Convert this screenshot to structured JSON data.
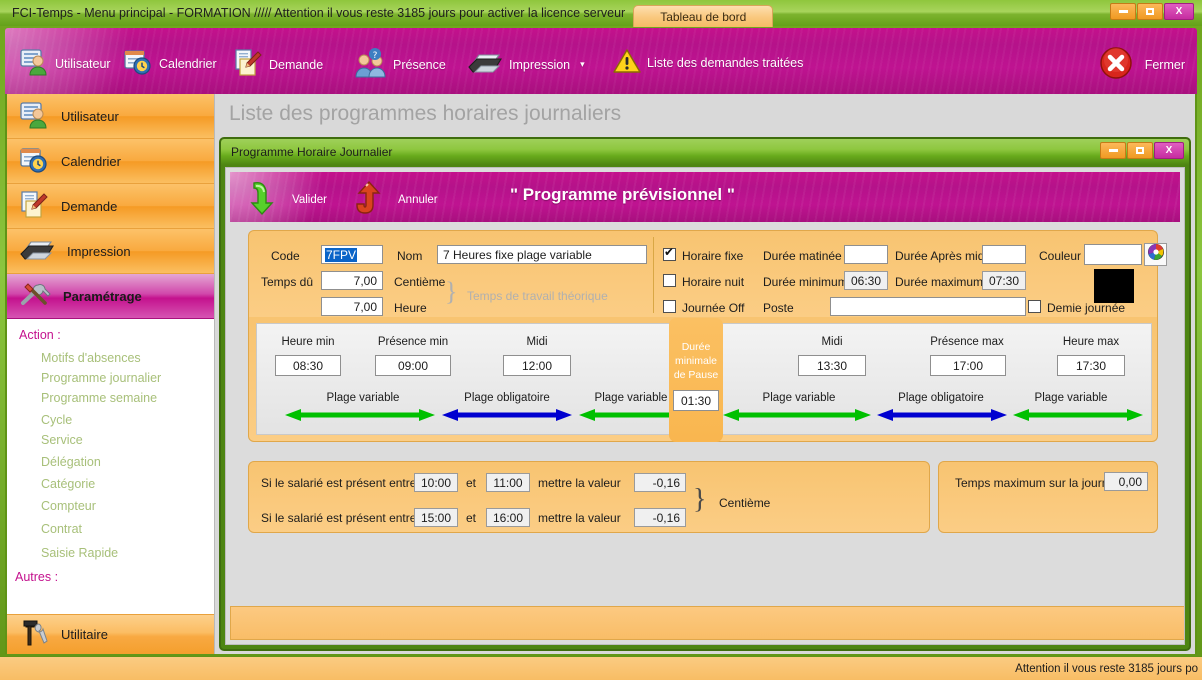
{
  "window": {
    "title": "FCI-Temps  -  Menu principal - FORMATION ///// Attention il vous reste 3185 jours pour activer la licence serveur",
    "dashboard_tab": "Tableau de bord",
    "minimize": "–",
    "maximize": "□",
    "close": "X"
  },
  "ribbon": {
    "items": [
      {
        "label": "Utilisateur",
        "icon": "user-card-icon"
      },
      {
        "label": "Calendrier",
        "icon": "calendar-clock-icon"
      },
      {
        "label": "Demande",
        "icon": "document-pen-icon"
      },
      {
        "label": "Présence",
        "icon": "people-question-icon"
      },
      {
        "label": "Impression",
        "icon": "printer-icon",
        "caret": "▾"
      },
      {
        "label": "Liste des demandes traitées",
        "icon": "warning-icon"
      }
    ],
    "close_label": "Fermer",
    "close_icon": "close-circle-icon"
  },
  "sidebar": {
    "nav": [
      {
        "label": "Utilisateur",
        "icon": "user-card-icon",
        "active": false
      },
      {
        "label": "Calendrier",
        "icon": "calendar-clock-icon",
        "active": false
      },
      {
        "label": "Demande",
        "icon": "document-pen-icon",
        "active": false
      },
      {
        "label": "Impression",
        "icon": "printer-icon",
        "active": false
      },
      {
        "label": "Paramétrage",
        "icon": "tools-icon",
        "active": true
      }
    ],
    "action_header": "Action :",
    "action_items": [
      "Motifs d'absences",
      "Programme journalier",
      "Programme semaine",
      "Cycle",
      "Service",
      "Délégation",
      "Catégorie",
      "Compteur",
      "Contrat"
    ],
    "autres_header": "Autres :",
    "autres_items": [
      "Saisie Rapide"
    ],
    "utilitaire": {
      "label": "Utilitaire",
      "icon": "hammer-wrench-icon"
    }
  },
  "content": {
    "page_title": "Liste des programmes horaires journaliers"
  },
  "dialog": {
    "title": "Programme Horaire Journalier",
    "minimize": "–",
    "maximize": "□",
    "close": "X",
    "validate_label": "Valider",
    "validate_icon": "green-arrow-down-icon",
    "cancel_label": "Annuler",
    "cancel_icon": "red-arrow-up-icon",
    "heading": "\" Programme prévisionnel \""
  },
  "form": {
    "code_label": "Code",
    "code_value": "7FPV",
    "nom_label": "Nom",
    "nom_value": "7 Heures fixe plage variable",
    "temps_du_label": "Temps dû",
    "centieme_value": "7,00",
    "centieme_label": "Centième",
    "heure_value": "7,00",
    "heure_label": "Heure",
    "theorique_note": "Temps de travail théorique",
    "horaire_fixe_label": "Horaire fixe",
    "horaire_fixe_checked": true,
    "horaire_nuit_label": "Horaire nuit",
    "horaire_nuit_checked": false,
    "journee_off_label": "Journée Off",
    "journee_off_checked": false,
    "duree_matinee_label": "Durée matinée",
    "duree_matinee_value": "",
    "duree_apres_midi_label": "Durée Après midi",
    "duree_apres_midi_value": "",
    "duree_minimum_label": "Durée minimum",
    "duree_minimum_value": "06:30",
    "duree_maximum_label": "Durée maximum",
    "duree_maximum_value": "07:30",
    "poste_label": "Poste",
    "poste_value": "",
    "couleur_label": "Couleur",
    "couleur_value": "",
    "couleur_picker_icon": "color-wheel-icon",
    "couleur_swatch": "#000000",
    "demie_journee_label": "Demie journée",
    "demie_journee_checked": false
  },
  "timeline": {
    "fields": [
      {
        "label": "Heure min",
        "value": "08:30"
      },
      {
        "label": "Présence min",
        "value": "09:00"
      },
      {
        "label": "Midi",
        "value": "12:00"
      },
      {
        "label": "Midi",
        "value": "13:30"
      },
      {
        "label": "Présence max",
        "value": "17:00"
      },
      {
        "label": "Heure max",
        "value": "17:30"
      }
    ],
    "pause": {
      "line1": "Durée",
      "line2": "minimale",
      "line3": "de Pause",
      "value": "01:30"
    },
    "bands": [
      {
        "label": "Plage variable",
        "color": "#00c000"
      },
      {
        "label": "Plage obligatoire",
        "color": "#0000d0"
      },
      {
        "label": "Plage variable",
        "color": "#00c000"
      },
      {
        "label": "Plage variable",
        "color": "#00c000"
      },
      {
        "label": "Plage obligatoire",
        "color": "#0000d0"
      },
      {
        "label": "Plage variable",
        "color": "#00c000"
      }
    ]
  },
  "rules": {
    "rows": [
      {
        "prefix": "Si le salarié est présent entre",
        "from": "10:00",
        "and": "et",
        "to": "11:00",
        "mid": "mettre la valeur",
        "value": "-0,16"
      },
      {
        "prefix": "Si le salarié est présent entre",
        "from": "15:00",
        "and": "et",
        "to": "16:00",
        "mid": "mettre la valeur",
        "value": "-0,16"
      }
    ],
    "unit": "Centième"
  },
  "max_day": {
    "label": "Temps maximum sur la journée",
    "value": "0,00"
  },
  "statusbar": {
    "text": "Attention il vous reste 3185 jours po"
  },
  "colors": {
    "green": "#8cc63f",
    "green_dark": "#4e8512",
    "magenta": "#bf1391",
    "orange": "#f9a93e",
    "band_green": "#00c000",
    "band_blue": "#0000d0"
  }
}
